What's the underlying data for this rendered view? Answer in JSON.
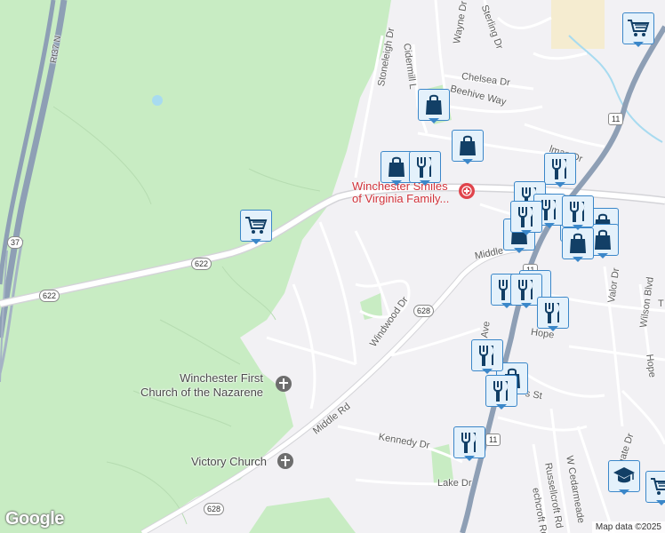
{
  "map": {
    "background": "#f2f1f4",
    "forest_color": "#c8ecc3",
    "water_color": "#a8dbf0",
    "highway_color": "#8e9fb5",
    "road_color": "#ffffff"
  },
  "roads": {
    "rt37": "Rt37 N",
    "shield_37": "37",
    "shield_622_a": "622",
    "shield_622_b": "622",
    "shield_628_a": "628",
    "shield_628_b": "628",
    "shield_11_a": "11",
    "shield_11_b": "11",
    "shield_11_c": "11",
    "middle_rd": "Middle Rd",
    "middle_rd_2": "Middle",
    "stoneleigh": "Stoneleigh Dr",
    "cidermill": "Cidermill L",
    "wayne": "Wayne Dr",
    "sterling": "Sterling Dr",
    "chelsea": "Chelsea Dr",
    "beehive": "Beehive Way",
    "windwood": "Windwood Dr",
    "kennedy": "Kennedy Dr",
    "lake": "Lake Dr",
    "valor": "Valor Dr",
    "wilson": "Wilson Blvd",
    "hope": "Hope",
    "hope2": "Hope",
    "st": "s St",
    "n_ave": "n Ave",
    "russellcroft": "Russellcroft Rd",
    "w_cedarmeade": "W Cedarmeade",
    "stonegate": "Stonegate Dr",
    "beechcroft": "echcroft Rd",
    "ulman": "lman Dr",
    "tr": "T"
  },
  "places": {
    "nazarene": "Winchester First\nChurch of the Nazarene",
    "victory": "Victory Church",
    "medical": "Winchester Smiles\nof Virginia Family..."
  },
  "icons": {
    "cart": "shopping-cart-icon",
    "bag": "shopping-bag-icon",
    "food": "restaurant-icon",
    "school": "school-icon",
    "church": "church-icon",
    "medical": "medical-icon"
  },
  "footer": {
    "logo": "Google",
    "attribution": "Map data ©2025"
  }
}
